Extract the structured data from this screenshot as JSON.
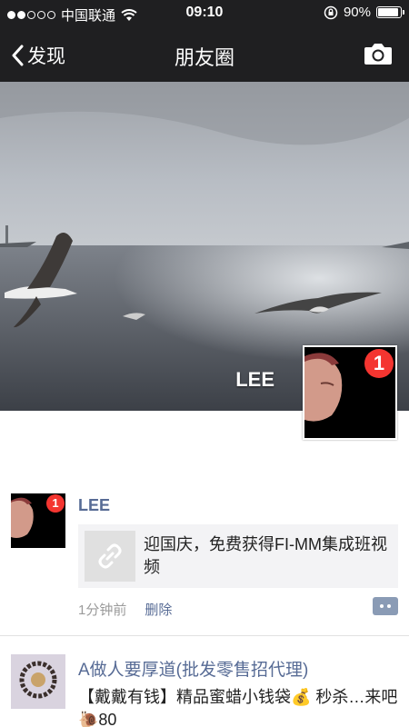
{
  "status": {
    "carrier": "中国联通",
    "time": "09:10",
    "battery": "90%",
    "battery_level": 0.9
  },
  "nav": {
    "back_label": "发现",
    "title": "朋友圈"
  },
  "cover": {
    "name": "LEE",
    "avatar_badge": "1"
  },
  "posts": [
    {
      "author": "LEE",
      "avatar_badge": "1",
      "link_text": "迎国庆，免费获得FI-MM集成班视频",
      "time": "1分钟前",
      "delete_label": "删除"
    },
    {
      "author": "A做人要厚道(批发零售招代理)",
      "text": "【戴戴有钱】精品蜜蜡小钱袋💰 秒杀…来吧🐌80"
    }
  ]
}
